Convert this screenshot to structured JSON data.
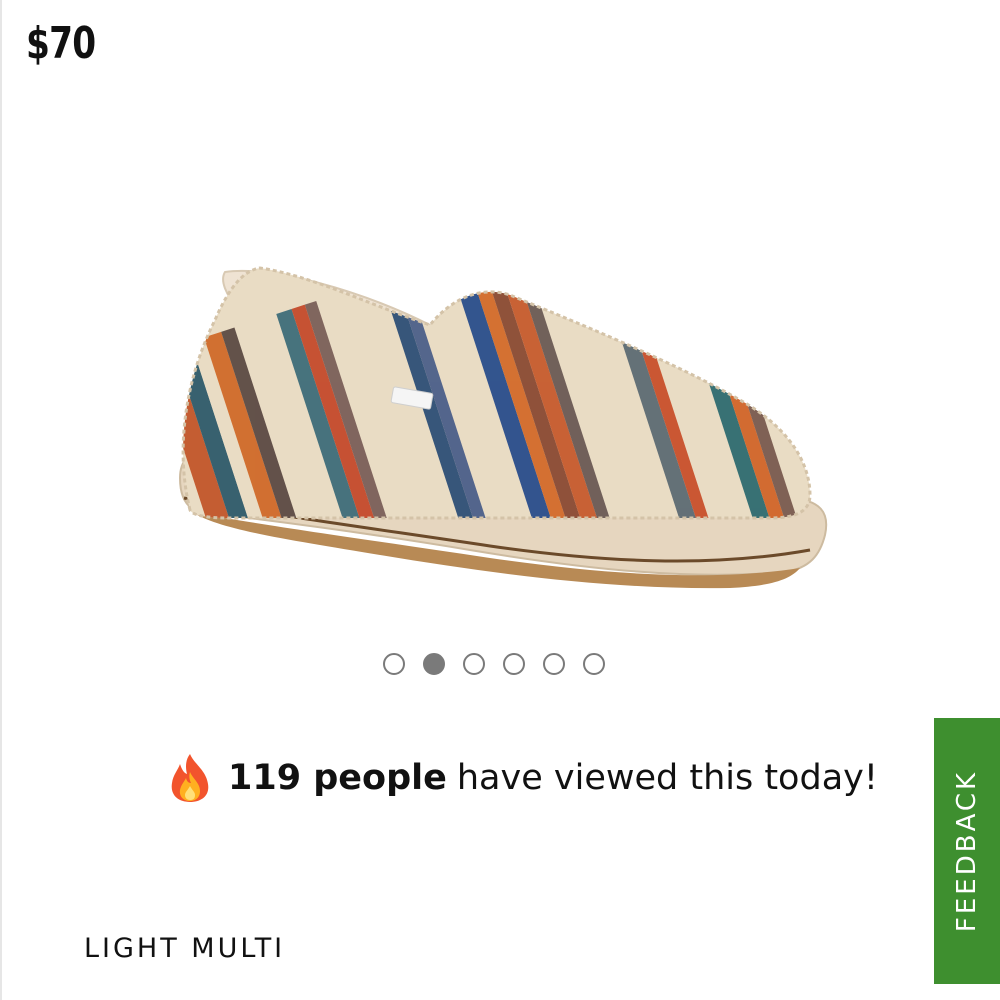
{
  "product": {
    "price": "$70",
    "image_alt": "Fleece striped slip-on shoe",
    "color_name": "LIGHT MULTI"
  },
  "carousel": {
    "total_slides": 6,
    "active_index": 1
  },
  "views_banner": {
    "icon": "fire-icon",
    "count_text": "119 people",
    "message": "have viewed this today!"
  },
  "feedback": {
    "label": "FEEDBACK",
    "color": "#3e8f2f"
  },
  "colors": {
    "dot_color": "#7a7a7a",
    "text": "#111111"
  }
}
